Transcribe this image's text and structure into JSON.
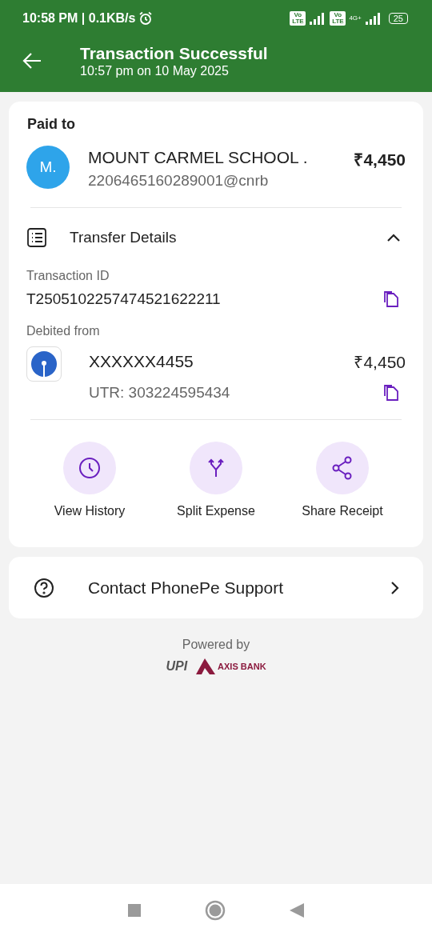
{
  "status_bar": {
    "time": "10:58 PM | 0.1KB/s",
    "sim_badges": [
      "Vo LTE",
      "Vo LTE"
    ],
    "network": "4G+",
    "battery": "25"
  },
  "header": {
    "title": "Transaction Successful",
    "subtitle": "10:57 pm on 10 May 2025"
  },
  "payment": {
    "heading": "Paid to",
    "avatar": "M.",
    "name": "MOUNT CARMEL SCHOOL .",
    "upi_id": "2206465160289001@cnrb",
    "amount": "₹4,450"
  },
  "transfer_details": {
    "title": "Transfer Details",
    "expanded": true,
    "transaction_id_label": "Transaction ID",
    "transaction_id": "T2505102257474521622211",
    "debited_label": "Debited from",
    "account": "XXXXXX4455",
    "debit_amount": "₹4,450",
    "utr": "UTR: 303224595434"
  },
  "actions": [
    {
      "kind": "history",
      "label": "View History"
    },
    {
      "kind": "split",
      "label": "Split Expense"
    },
    {
      "kind": "share",
      "label": "Share Receipt"
    }
  ],
  "support": {
    "label": "Contact PhonePe Support"
  },
  "footer": {
    "powered_by": "Powered by",
    "upi_logo": "UPI",
    "bank_logo": "AXIS BANK"
  }
}
